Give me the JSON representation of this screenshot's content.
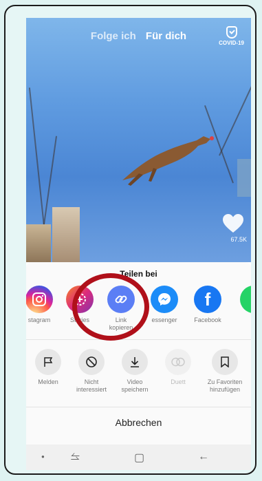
{
  "top_nav": {
    "following": "Folge ich",
    "for_you": "Für dich"
  },
  "covid_badge": "COVID-19",
  "likes_count": "67.5K",
  "share_sheet": {
    "title": "Teilen bei",
    "apps": [
      {
        "label": "stagram",
        "icon": "instagram-icon",
        "color": "#d6249f"
      },
      {
        "label": "Stories",
        "icon": "stories-icon",
        "color": "#a43fd1"
      },
      {
        "label": "Link\nkopieren",
        "icon": "link-icon",
        "color": "#5b7ef5"
      },
      {
        "label": "essenger",
        "icon": "messenger-icon",
        "color": "#1c8cf8"
      },
      {
        "label": "Facebook",
        "icon": "facebook-icon",
        "color": "#1877f2"
      }
    ],
    "actions": [
      {
        "label": "Melden",
        "icon": "flag-icon"
      },
      {
        "label": "Nicht\ninteressiert",
        "icon": "block-icon"
      },
      {
        "label": "Video\nspeichern",
        "icon": "download-icon"
      },
      {
        "label": "Duett",
        "icon": "duet-icon"
      },
      {
        "label": "Zu Favoriten\nhinzufügen",
        "icon": "bookmark-icon"
      }
    ],
    "cancel": "Abbrechen"
  }
}
